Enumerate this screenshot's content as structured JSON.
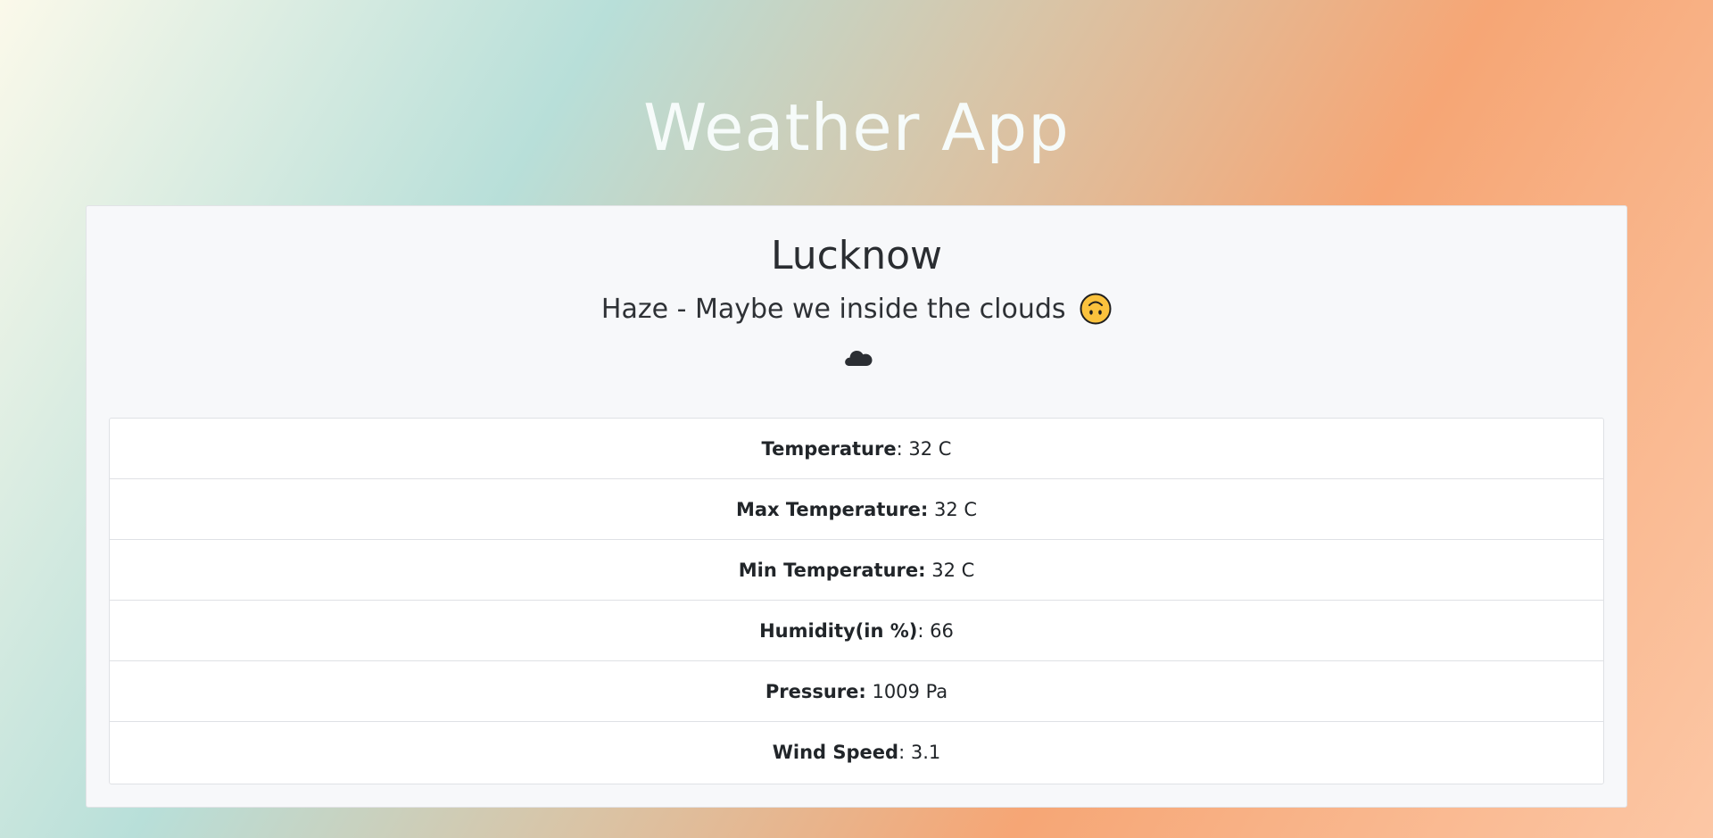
{
  "app": {
    "title": "Weather App"
  },
  "weather": {
    "city": "Lucknow",
    "description": "Haze - Maybe we inside the clouds",
    "emoji_icon": "upside-down-face-icon",
    "condition_icon": "cloud-icon"
  },
  "details": [
    {
      "label": "Temperature",
      "separator": ": ",
      "value": "32 C"
    },
    {
      "label": "Max Temperature:",
      "separator": " ",
      "value": "32 C"
    },
    {
      "label": "Min Temperature:",
      "separator": " ",
      "value": "32 C"
    },
    {
      "label": "Humidity(in %)",
      "separator": ": ",
      "value": "66"
    },
    {
      "label": "Pressure:",
      "separator": " ",
      "value": "1009 Pa"
    },
    {
      "label": "Wind Speed",
      "separator": ": ",
      "value": "3.1"
    }
  ],
  "colors": {
    "title_text": "#f6fbfa",
    "card_background": "#f7f8fa",
    "list_background": "#ffffff",
    "emoji_fill": "#fbc23d"
  }
}
